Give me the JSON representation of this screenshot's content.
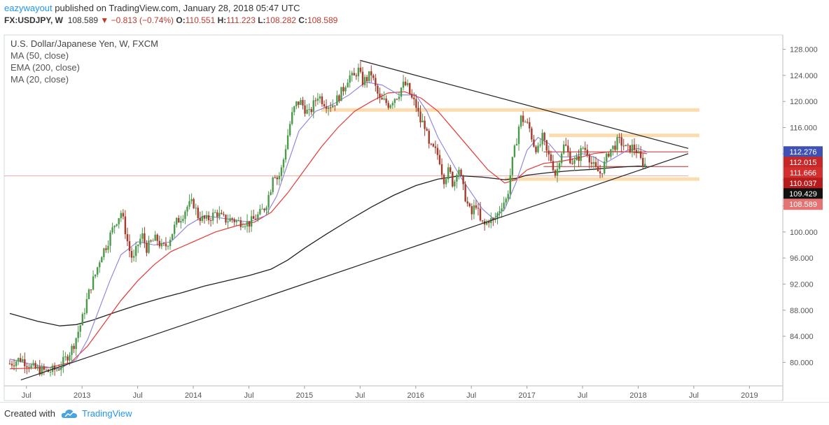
{
  "header": {
    "author": "eazywayout",
    "published_text": "published on TradingView.com, January 28, 2018 05:47 UTC",
    "symbol": "FX:USDJPY, W",
    "last": "108.589",
    "change": "−0.813 (−0.74%)",
    "o_label": "O:",
    "o_value": "110.551",
    "h_label": "H:",
    "h_value": "111.223",
    "l_label": "L:",
    "l_value": "108.282",
    "c_label": "C:",
    "c_value": "108.589"
  },
  "legend": {
    "title": "U.S. Dollar/Japanese Yen, W, FXCM",
    "ma50": "MA (50, close)",
    "ema200": "EMA (200, close)",
    "ma20": "MA (20, close)"
  },
  "footer": {
    "created_with": "Created with",
    "brand": "TradingView"
  },
  "colors": {
    "up": "#4a9a4a",
    "down": "#a33a2a",
    "ma50": "#e53935",
    "ema200": "#222222",
    "ma20": "#8c7fe0",
    "zone": "#fbd5a0",
    "accent": "#2196f3"
  },
  "chart_data": {
    "type": "candlestick",
    "ylim": [
      76.4,
      130.2
    ],
    "y_ticks": [
      "128.000",
      "124.000",
      "120.000",
      "116.000",
      "112.000",
      "108.000",
      "104.000",
      "100.000",
      "96.000",
      "92.000",
      "88.000",
      "84.000",
      "80.000"
    ],
    "y_tick_values": [
      128,
      124,
      120,
      116,
      112,
      108,
      104,
      100,
      96,
      92,
      88,
      84,
      80
    ],
    "x_ticks": [
      "Jul",
      "2013",
      "Jul",
      "2014",
      "Jul",
      "2015",
      "Jul",
      "2016",
      "Jul",
      "2017",
      "Jul",
      "2018",
      "Jul",
      "2019"
    ],
    "x_tick_years": [
      2012.5,
      2013,
      2013.5,
      2014,
      2014.5,
      2015,
      2015.5,
      2016,
      2016.5,
      2017,
      2017.5,
      2018,
      2018.5,
      2019
    ],
    "price_labels": [
      {
        "text": "112.276",
        "value": 112.276,
        "color": "#3f51b5"
      },
      {
        "text": "112.015",
        "value": 112.015,
        "color": "#c62828"
      },
      {
        "text": "111.666",
        "value": 111.666,
        "color": "#d32f2f"
      },
      {
        "text": "110.037",
        "value": 110.037,
        "color": "#b71c1c"
      },
      {
        "text": "109.429",
        "value": 109.429,
        "color": "#111111"
      },
      {
        "text": "108.589",
        "value": 108.589,
        "color": "#e57373"
      }
    ],
    "close_path": [
      [
        2012.35,
        79.8
      ],
      [
        2012.45,
        80.6
      ],
      [
        2012.55,
        79.2
      ],
      [
        2012.62,
        78.8
      ],
      [
        2012.7,
        78.6
      ],
      [
        2012.78,
        79.0
      ],
      [
        2012.85,
        80.5
      ],
      [
        2012.92,
        82.5
      ],
      [
        2013.0,
        86.5
      ],
      [
        2013.04,
        89.3
      ],
      [
        2013.08,
        91.8
      ],
      [
        2013.12,
        93.5
      ],
      [
        2013.17,
        96.5
      ],
      [
        2013.22,
        98.0
      ],
      [
        2013.26,
        99.8
      ],
      [
        2013.3,
        101.5
      ],
      [
        2013.35,
        103.0
      ],
      [
        2013.38,
        101.0
      ],
      [
        2013.42,
        97.5
      ],
      [
        2013.46,
        95.5
      ],
      [
        2013.5,
        98.0
      ],
      [
        2013.54,
        99.5
      ],
      [
        2013.58,
        97.5
      ],
      [
        2013.63,
        98.5
      ],
      [
        2013.67,
        99.0
      ],
      [
        2013.72,
        97.5
      ],
      [
        2013.76,
        98.0
      ],
      [
        2013.8,
        99.5
      ],
      [
        2013.85,
        101.5
      ],
      [
        2013.9,
        102.5
      ],
      [
        2013.94,
        103.8
      ],
      [
        2014.0,
        104.5
      ],
      [
        2014.04,
        102.5
      ],
      [
        2014.08,
        102.0
      ],
      [
        2014.12,
        101.8
      ],
      [
        2014.17,
        102.5
      ],
      [
        2014.21,
        103.0
      ],
      [
        2014.25,
        102.2
      ],
      [
        2014.3,
        101.8
      ],
      [
        2014.35,
        102.0
      ],
      [
        2014.4,
        101.5
      ],
      [
        2014.45,
        101.6
      ],
      [
        2014.5,
        101.3
      ],
      [
        2014.55,
        102.0
      ],
      [
        2014.6,
        102.8
      ],
      [
        2014.65,
        104.0
      ],
      [
        2014.7,
        107.0
      ],
      [
        2014.72,
        109.5
      ],
      [
        2014.76,
        108.0
      ],
      [
        2014.8,
        110.0
      ],
      [
        2014.84,
        114.0
      ],
      [
        2014.88,
        117.5
      ],
      [
        2014.92,
        119.5
      ],
      [
        2014.96,
        120.0
      ],
      [
        2015.0,
        119.0
      ],
      [
        2015.04,
        118.0
      ],
      [
        2015.08,
        119.5
      ],
      [
        2015.12,
        121.0
      ],
      [
        2015.17,
        120.0
      ],
      [
        2015.21,
        119.5
      ],
      [
        2015.25,
        119.5
      ],
      [
        2015.3,
        120.5
      ],
      [
        2015.35,
        122.0
      ],
      [
        2015.4,
        124.0
      ],
      [
        2015.44,
        123.5
      ],
      [
        2015.48,
        125.0
      ],
      [
        2015.52,
        123.0
      ],
      [
        2015.56,
        123.5
      ],
      [
        2015.6,
        124.3
      ],
      [
        2015.64,
        122.0
      ],
      [
        2015.68,
        120.0
      ],
      [
        2015.72,
        120.0
      ],
      [
        2015.76,
        119.5
      ],
      [
        2015.8,
        120.5
      ],
      [
        2015.84,
        121.0
      ],
      [
        2015.88,
        122.5
      ],
      [
        2015.92,
        122.5
      ],
      [
        2015.96,
        120.5
      ],
      [
        2016.0,
        119.5
      ],
      [
        2016.04,
        117.0
      ],
      [
        2016.08,
        116.5
      ],
      [
        2016.12,
        113.0
      ],
      [
        2016.17,
        112.5
      ],
      [
        2016.21,
        111.5
      ],
      [
        2016.25,
        108.0
      ],
      [
        2016.3,
        109.5
      ],
      [
        2016.34,
        107.0
      ],
      [
        2016.38,
        110.5
      ],
      [
        2016.42,
        107.0
      ],
      [
        2016.46,
        104.5
      ],
      [
        2016.5,
        102.5
      ],
      [
        2016.54,
        104.5
      ],
      [
        2016.58,
        101.5
      ],
      [
        2016.62,
        101.0
      ],
      [
        2016.66,
        102.0
      ],
      [
        2016.7,
        101.5
      ],
      [
        2016.74,
        103.0
      ],
      [
        2016.78,
        104.5
      ],
      [
        2016.82,
        105.0
      ],
      [
        2016.86,
        110.0
      ],
      [
        2016.9,
        113.5
      ],
      [
        2016.94,
        117.5
      ],
      [
        2016.98,
        117.0
      ],
      [
        2017.02,
        116.0
      ],
      [
        2017.06,
        113.5
      ],
      [
        2017.1,
        112.5
      ],
      [
        2017.14,
        114.5
      ],
      [
        2017.18,
        112.0
      ],
      [
        2017.22,
        111.0
      ],
      [
        2017.26,
        108.5
      ],
      [
        2017.3,
        112.0
      ],
      [
        2017.34,
        113.5
      ],
      [
        2017.38,
        111.5
      ],
      [
        2017.42,
        110.5
      ],
      [
        2017.46,
        111.3
      ],
      [
        2017.5,
        113.0
      ],
      [
        2017.54,
        112.5
      ],
      [
        2017.58,
        110.5
      ],
      [
        2017.62,
        109.5
      ],
      [
        2017.66,
        109.0
      ],
      [
        2017.7,
        110.5
      ],
      [
        2017.74,
        112.5
      ],
      [
        2017.78,
        113.0
      ],
      [
        2017.82,
        114.0
      ],
      [
        2017.86,
        113.5
      ],
      [
        2017.9,
        112.5
      ],
      [
        2017.94,
        113.0
      ],
      [
        2017.98,
        112.7
      ],
      [
        2018.02,
        111.0
      ],
      [
        2018.06,
        110.5
      ],
      [
        2018.08,
        108.6
      ]
    ],
    "ma20_path": [
      [
        2012.35,
        80.5
      ],
      [
        2012.6,
        79.5
      ],
      [
        2012.8,
        79.0
      ],
      [
        2012.95,
        80.5
      ],
      [
        2013.05,
        83.5
      ],
      [
        2013.15,
        88.0
      ],
      [
        2013.25,
        92.5
      ],
      [
        2013.35,
        96.5
      ],
      [
        2013.5,
        98.5
      ],
      [
        2013.65,
        98.0
      ],
      [
        2013.8,
        98.5
      ],
      [
        2013.95,
        101.0
      ],
      [
        2014.1,
        102.5
      ],
      [
        2014.3,
        102.0
      ],
      [
        2014.5,
        101.5
      ],
      [
        2014.65,
        102.5
      ],
      [
        2014.75,
        105.5
      ],
      [
        2014.85,
        110.5
      ],
      [
        2014.95,
        115.5
      ],
      [
        2015.1,
        118.5
      ],
      [
        2015.25,
        119.5
      ],
      [
        2015.4,
        121.0
      ],
      [
        2015.55,
        123.0
      ],
      [
        2015.7,
        122.5
      ],
      [
        2015.85,
        121.0
      ],
      [
        2016.0,
        121.0
      ],
      [
        2016.1,
        118.5
      ],
      [
        2016.2,
        114.5
      ],
      [
        2016.3,
        111.5
      ],
      [
        2016.4,
        108.5
      ],
      [
        2016.5,
        106.0
      ],
      [
        2016.6,
        103.5
      ],
      [
        2016.7,
        102.0
      ],
      [
        2016.8,
        103.5
      ],
      [
        2016.9,
        107.5
      ],
      [
        2017.0,
        112.5
      ],
      [
        2017.1,
        114.5
      ],
      [
        2017.2,
        113.5
      ],
      [
        2017.3,
        111.5
      ],
      [
        2017.4,
        111.5
      ],
      [
        2017.5,
        112.0
      ],
      [
        2017.6,
        111.5
      ],
      [
        2017.7,
        110.5
      ],
      [
        2017.8,
        111.5
      ],
      [
        2017.9,
        112.5
      ],
      [
        2018.0,
        112.8
      ],
      [
        2018.08,
        112.27
      ]
    ],
    "ma50_path": [
      [
        2012.35,
        79.0
      ],
      [
        2012.7,
        79.2
      ],
      [
        2012.9,
        80.0
      ],
      [
        2013.05,
        82.5
      ],
      [
        2013.2,
        86.0
      ],
      [
        2013.35,
        89.5
      ],
      [
        2013.5,
        92.5
      ],
      [
        2013.65,
        95.0
      ],
      [
        2013.8,
        97.0
      ],
      [
        2014.0,
        98.5
      ],
      [
        2014.2,
        100.0
      ],
      [
        2014.4,
        101.0
      ],
      [
        2014.55,
        101.5
      ],
      [
        2014.7,
        103.0
      ],
      [
        2014.85,
        106.0
      ],
      [
        2015.0,
        109.5
      ],
      [
        2015.15,
        113.0
      ],
      [
        2015.3,
        116.0
      ],
      [
        2015.45,
        118.5
      ],
      [
        2015.6,
        120.0
      ],
      [
        2015.75,
        121.3
      ],
      [
        2015.9,
        121.5
      ],
      [
        2016.05,
        120.5
      ],
      [
        2016.2,
        118.5
      ],
      [
        2016.35,
        115.5
      ],
      [
        2016.5,
        112.5
      ],
      [
        2016.65,
        109.5
      ],
      [
        2016.8,
        107.5
      ],
      [
        2016.9,
        108.0
      ],
      [
        2017.0,
        109.5
      ],
      [
        2017.15,
        110.5
      ],
      [
        2017.3,
        110.8
      ],
      [
        2017.45,
        111.3
      ],
      [
        2017.6,
        112.0
      ],
      [
        2017.75,
        112.3
      ],
      [
        2017.9,
        112.3
      ],
      [
        2018.08,
        112.0
      ]
    ],
    "ema200_path": [
      [
        2012.35,
        87.5
      ],
      [
        2012.6,
        86.3
      ],
      [
        2012.8,
        85.6
      ],
      [
        2012.95,
        85.8
      ],
      [
        2013.1,
        86.5
      ],
      [
        2013.3,
        87.7
      ],
      [
        2013.5,
        88.8
      ],
      [
        2013.7,
        89.8
      ],
      [
        2013.9,
        90.7
      ],
      [
        2014.1,
        91.7
      ],
      [
        2014.3,
        92.5
      ],
      [
        2014.5,
        93.3
      ],
      [
        2014.7,
        94.3
      ],
      [
        2014.85,
        95.7
      ],
      [
        2015.0,
        97.5
      ],
      [
        2015.2,
        99.7
      ],
      [
        2015.4,
        101.8
      ],
      [
        2015.6,
        103.8
      ],
      [
        2015.8,
        105.6
      ],
      [
        2016.0,
        107.1
      ],
      [
        2016.2,
        108.1
      ],
      [
        2016.4,
        108.6
      ],
      [
        2016.6,
        108.4
      ],
      [
        2016.8,
        108.0
      ],
      [
        2016.9,
        108.2
      ],
      [
        2017.0,
        108.7
      ],
      [
        2017.2,
        109.1
      ],
      [
        2017.4,
        109.4
      ],
      [
        2017.6,
        109.6
      ],
      [
        2017.8,
        109.9
      ],
      [
        2018.0,
        110.1
      ],
      [
        2018.08,
        110.03
      ]
    ],
    "trendlines": [
      {
        "from": [
          2012.45,
          77.3
        ],
        "to": [
          2018.45,
          112.0
        ]
      },
      {
        "from": [
          2015.5,
          126.3
        ],
        "to": [
          2018.45,
          112.8
        ]
      }
    ],
    "zones": [
      {
        "from": 2015.15,
        "to": 2018.55,
        "value": 118.7
      },
      {
        "from": 2017.2,
        "to": 2018.55,
        "value": 114.8
      },
      {
        "from": 2016.8,
        "to": 2018.55,
        "value": 108.1
      }
    ],
    "levels": [
      {
        "from": 2017.15,
        "to": 2018.45,
        "value": 112.27,
        "color": "#c62828"
      },
      {
        "from": 2017.15,
        "to": 2018.45,
        "value": 110.03,
        "color": "#c62828"
      },
      {
        "from": 2012.3,
        "to": 2018.45,
        "value": 108.59,
        "color": "#f4a7a0"
      }
    ]
  }
}
